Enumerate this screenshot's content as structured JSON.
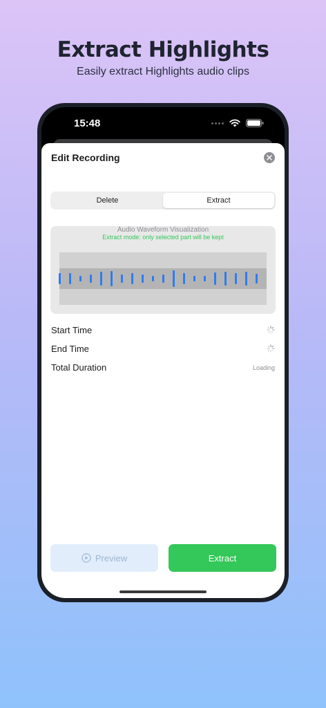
{
  "promo": {
    "title": "Extract Highlights",
    "subtitle": "Easily extract Highlights audio clips"
  },
  "status_bar": {
    "time": "15:48"
  },
  "sheet": {
    "title": "Edit Recording",
    "modes": [
      "Delete",
      "Extract"
    ],
    "selected_mode": "Extract"
  },
  "waveform": {
    "title": "Audio Waveform Visualization",
    "hint": "Extract mode: only selected part will be kept",
    "bar_levels": [
      0.6,
      0.55,
      0.3,
      0.45,
      0.7,
      0.8,
      0.45,
      0.55,
      0.4,
      0.3,
      0.45,
      0.85,
      0.55,
      0.3,
      0.3,
      0.65,
      0.7,
      0.55,
      0.7,
      0.5
    ],
    "accent_color": "#2f7cf0"
  },
  "details": {
    "start_label": "Start Time",
    "end_label": "End Time",
    "duration_label": "Total Duration",
    "duration_value": "Loading"
  },
  "actions": {
    "preview_label": "Preview",
    "extract_label": "Extract",
    "extract_color": "#34c759"
  }
}
